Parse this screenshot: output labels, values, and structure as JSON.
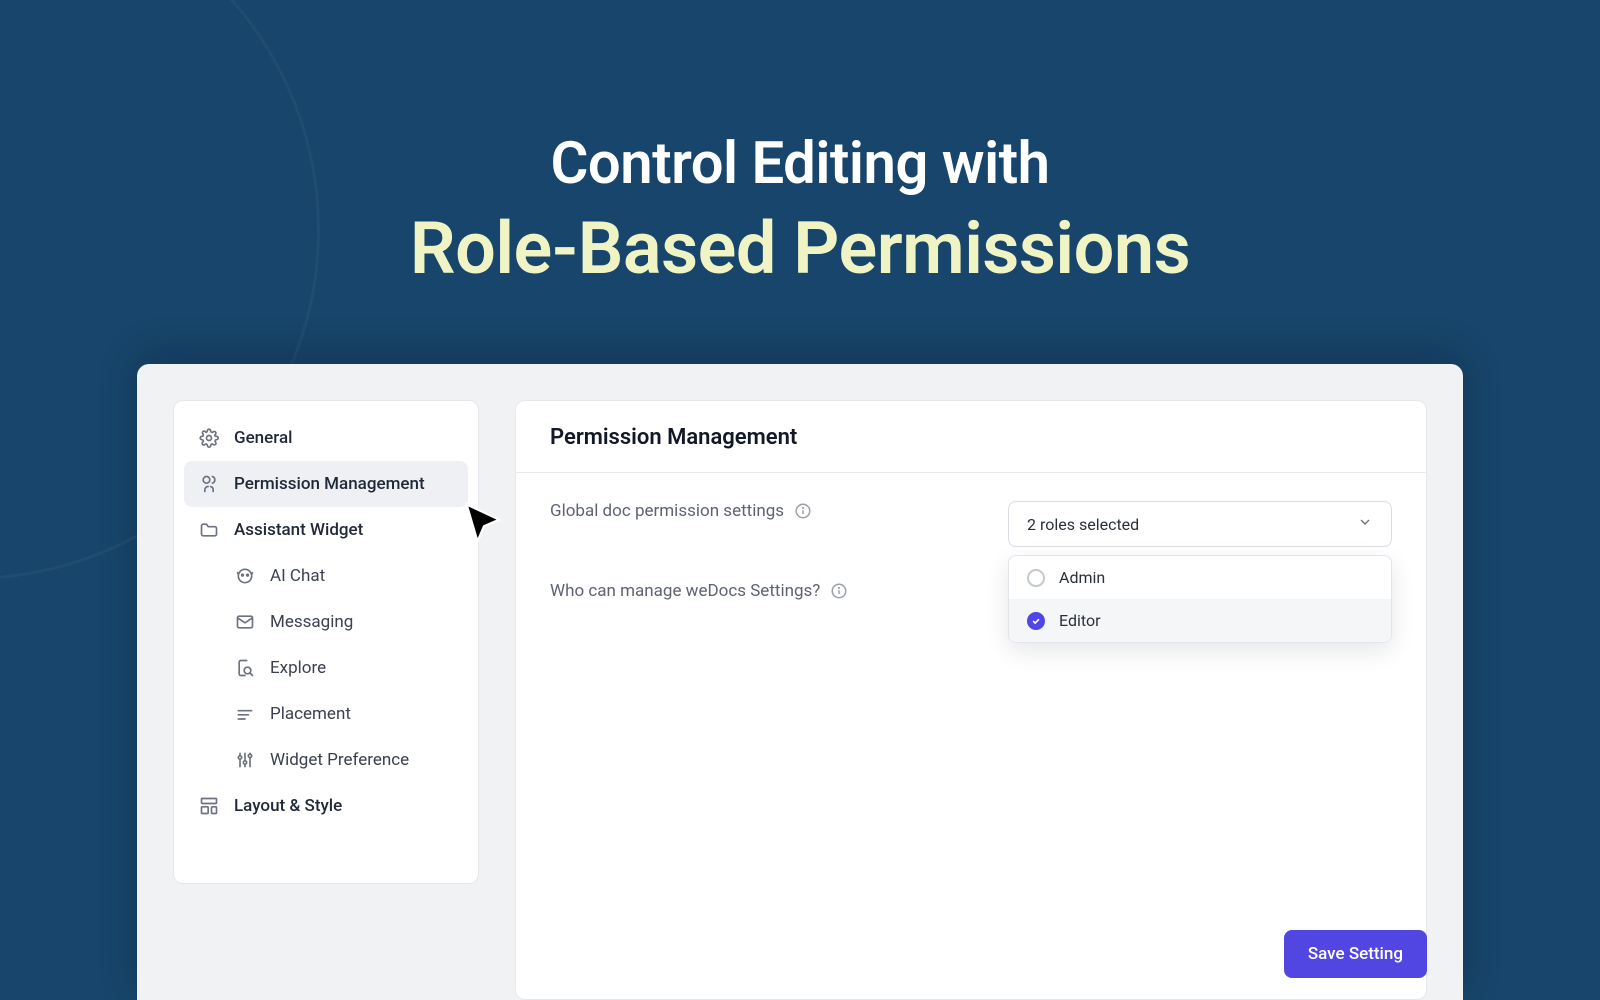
{
  "hero": {
    "line1": "Control Editing with",
    "line2": "Role-Based Permissions"
  },
  "sidebar": {
    "items": [
      {
        "label": "General"
      },
      {
        "label": "Permission Management"
      },
      {
        "label": "Assistant Widget"
      }
    ],
    "subitems": [
      {
        "label": "AI Chat"
      },
      {
        "label": "Messaging"
      },
      {
        "label": "Explore"
      },
      {
        "label": "Placement"
      },
      {
        "label": "Widget Preference"
      }
    ],
    "last": {
      "label": "Layout & Style"
    }
  },
  "panel": {
    "title": "Permission Management",
    "settings": {
      "global_doc_label": "Global doc permission settings",
      "manage_label": "Who can manage weDocs Settings?"
    },
    "select": {
      "display": "2 roles selected",
      "options": [
        {
          "label": "Admin",
          "selected": false
        },
        {
          "label": "Editor",
          "selected": true
        }
      ]
    }
  },
  "actions": {
    "save": "Save Setting"
  }
}
